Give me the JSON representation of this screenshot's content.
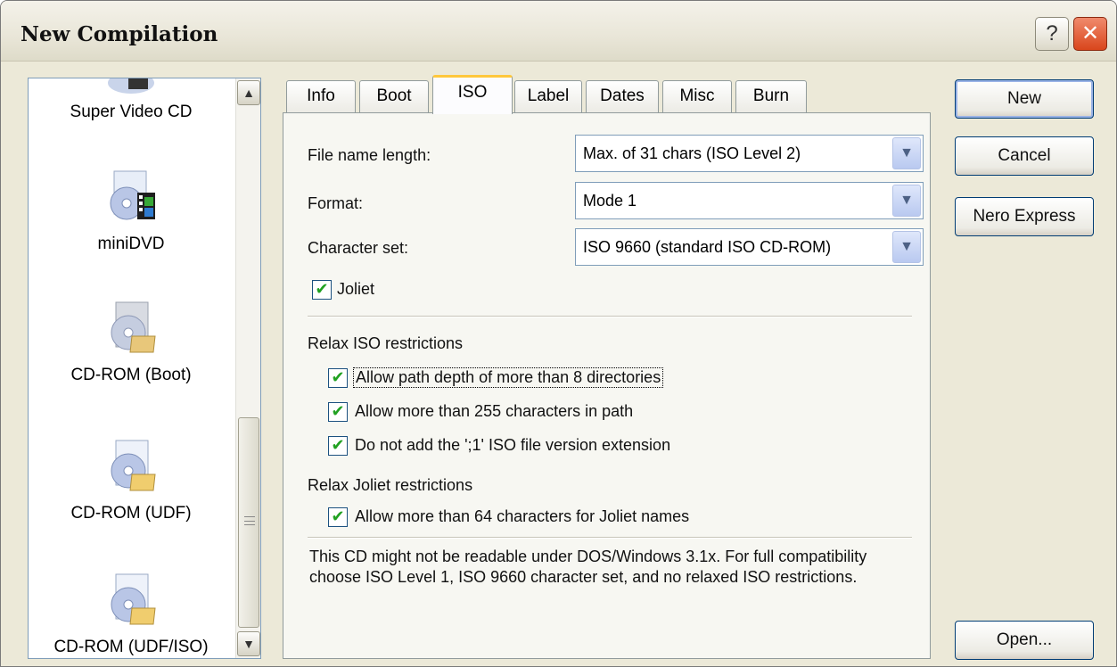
{
  "window": {
    "title": "New Compilation",
    "help_glyph": "?",
    "close_glyph": "✕"
  },
  "list": {
    "items": [
      {
        "label": "Super Video CD",
        "icon": "super-video-cd-icon"
      },
      {
        "label": "miniDVD",
        "icon": "minidvd-icon"
      },
      {
        "label": "CD-ROM (Boot)",
        "icon": "cd-rom-boot-icon",
        "selected": true
      },
      {
        "label": "CD-ROM (UDF)",
        "icon": "cd-rom-udf-icon"
      },
      {
        "label": "CD-ROM (UDF/ISO)",
        "icon": "cd-rom-udf-iso-icon"
      }
    ],
    "scroll_up": "▲",
    "scroll_down": "▼"
  },
  "tabs": [
    "Info",
    "Boot",
    "ISO",
    "Label",
    "Dates",
    "Misc",
    "Burn"
  ],
  "active_tab": "ISO",
  "iso": {
    "file_name_length_label": "File name length:",
    "file_name_length_value": "Max. of 31 chars (ISO Level 2)",
    "format_label": "Format:",
    "format_value": "Mode 1",
    "charset_label": "Character set:",
    "charset_value": "ISO 9660 (standard ISO CD-ROM)",
    "joliet_label": "Joliet",
    "joliet_checked": true,
    "relax_iso_heading": "Relax ISO restrictions",
    "relax_iso_options": [
      {
        "label": "Allow path depth of more than 8 directories",
        "checked": true
      },
      {
        "label": "Allow more than 255 characters in path",
        "checked": true
      },
      {
        "label": "Do not add the ';1' ISO file version extension",
        "checked": true
      }
    ],
    "relax_joliet_heading": "Relax Joliet restrictions",
    "relax_joliet_options": [
      {
        "label": "Allow more than 64 characters for Joliet names",
        "checked": true
      }
    ],
    "note": "This CD might not be readable under DOS/Windows 3.1x. For full compatibility choose ISO Level 1, ISO 9660 character set, and no relaxed ISO restrictions."
  },
  "buttons": {
    "new": "New",
    "cancel": "Cancel",
    "nero_express": "Nero Express",
    "open": "Open..."
  },
  "combo_arrow": "▼",
  "check_glyph": "✔"
}
